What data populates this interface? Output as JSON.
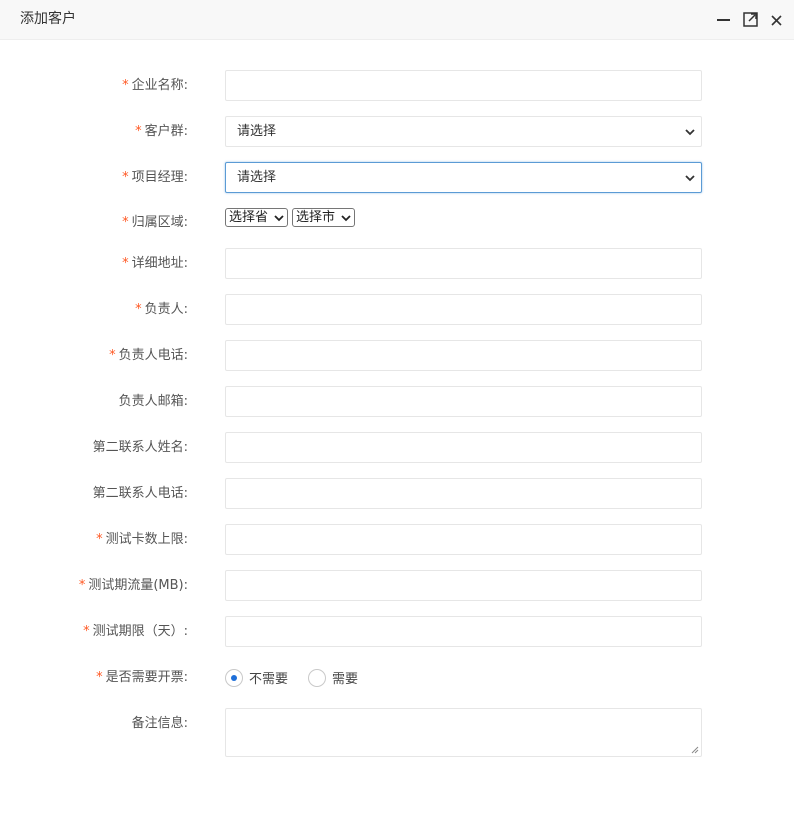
{
  "window": {
    "title": "添加客户",
    "controls": {
      "minimize_icon": "minimize-icon",
      "maximize_icon": "maximize-icon",
      "close_icon": "close-icon"
    }
  },
  "form": {
    "required_mark": "*",
    "company_name": {
      "label": "企业名称:",
      "value": ""
    },
    "customer_group": {
      "label": "客户群:",
      "selected": "请选择"
    },
    "project_manager": {
      "label": "项目经理:",
      "selected": "请选择"
    },
    "region": {
      "label": "归属区域:",
      "province": "选择省",
      "city": "选择市"
    },
    "address": {
      "label": "详细地址:",
      "value": ""
    },
    "owner": {
      "label": "负责人:",
      "value": ""
    },
    "owner_phone": {
      "label": "负责人电话:",
      "value": ""
    },
    "owner_email": {
      "label": "负责人邮箱:",
      "value": ""
    },
    "second_contact_name": {
      "label": "第二联系人姓名:",
      "value": ""
    },
    "second_contact_phone": {
      "label": "第二联系人电话:",
      "value": ""
    },
    "test_card_limit": {
      "label": "测试卡数上限:",
      "value": ""
    },
    "test_traffic": {
      "label": "测试期流量(MB):",
      "value": ""
    },
    "test_period": {
      "label": "测试期限（天）:",
      "value": ""
    },
    "invoice": {
      "label": "是否需要开票:",
      "options": [
        "不需要",
        "需要"
      ],
      "selected": "不需要"
    },
    "remarks": {
      "label": "备注信息:",
      "value": ""
    }
  },
  "colors": {
    "required": "#ff5722",
    "focus_border": "#5b9bd5",
    "radio_selected": "#1e6fd9"
  }
}
